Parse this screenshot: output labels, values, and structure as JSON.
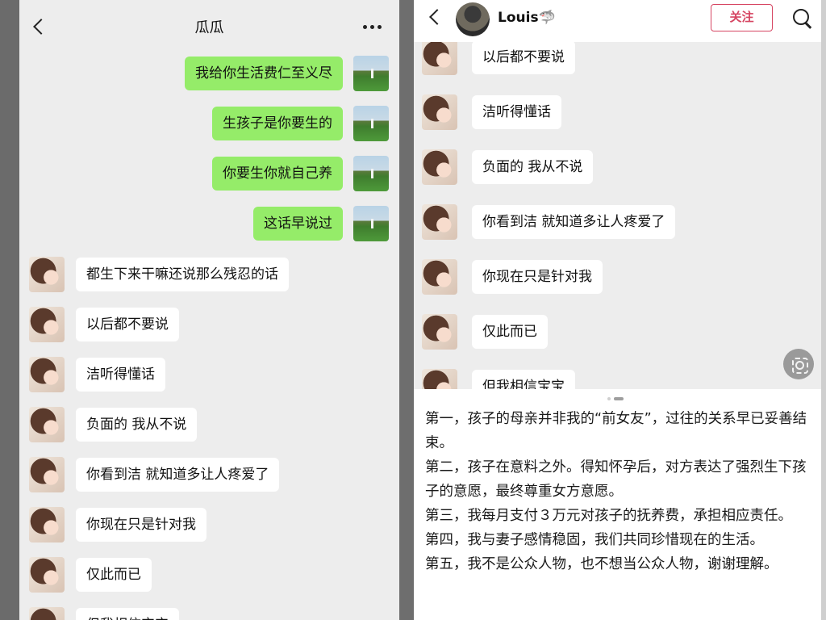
{
  "left_chat": {
    "title": "瓜瓜",
    "messages": [
      {
        "side": "out",
        "text": "我给你生活费仁至义尽"
      },
      {
        "side": "out",
        "text": "生孩子是你要生的"
      },
      {
        "side": "out",
        "text": "你要生你就自己养"
      },
      {
        "side": "out",
        "text": "这话早说过"
      },
      {
        "side": "in",
        "text": "都生下来干嘛还说那么残忍的话"
      },
      {
        "side": "in",
        "text": "以后都不要说"
      },
      {
        "side": "in",
        "text": "洁听得懂话"
      },
      {
        "side": "in",
        "text": "负面的 我从不说"
      },
      {
        "side": "in",
        "text": "你看到洁 就知道多让人疼爱了"
      },
      {
        "side": "in",
        "text": "你现在只是针对我"
      },
      {
        "side": "in",
        "text": "仅此而已"
      },
      {
        "side": "in",
        "text": "但我相信宝宝"
      }
    ]
  },
  "right_post": {
    "header": {
      "name": "Louis🦈",
      "follow_label": "关注"
    },
    "screenshot_messages": [
      "以后都不要说",
      "洁听得懂话",
      "负面的 我从不说",
      "你看到洁 就知道多让人疼爱了",
      "你现在只是针对我",
      "仅此而已",
      "但我相信宝宝"
    ],
    "statement": [
      "第一，孩子的母亲并非我的“前女友”，过往的关系早已妥善结束。",
      "第二，孩子在意料之外。得知怀孕后，对方表达了强烈生下孩子的意愿，最终尊重女方意愿。",
      "第三，我每月支付３万元对孩子的抚养费，承担相应责任。",
      "第四，我与妻子感情稳固，我们共同珍惜现在的生活。",
      "第五，我不是公众人物，也不想当公众人物，谢谢理解。"
    ]
  },
  "colors": {
    "outgoing_bubble": "#95ec69",
    "incoming_bubble": "#ffffff",
    "chat_background": "#ededed",
    "follow_accent": "#d64562"
  },
  "icons": [
    "back-icon",
    "more-icon",
    "search-icon",
    "lens-icon"
  ]
}
